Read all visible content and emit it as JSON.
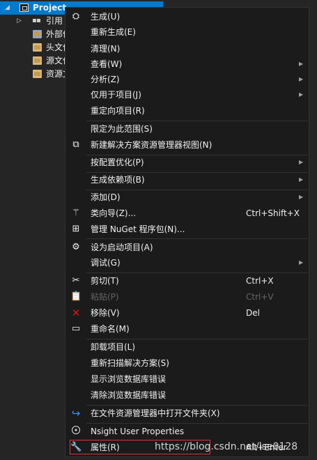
{
  "tree": {
    "project_label": "Project",
    "items": [
      {
        "label": "引用"
      },
      {
        "label": "外部依"
      },
      {
        "label": "头文件"
      },
      {
        "label": "源文件"
      },
      {
        "label": "资源文"
      }
    ]
  },
  "menu": {
    "build": {
      "label": "生成(U)"
    },
    "rebuild": {
      "label": "重新生成(E)"
    },
    "clean": {
      "label": "清理(N)"
    },
    "view": {
      "label": "查看(W)"
    },
    "analyze": {
      "label": "分析(Z)"
    },
    "project_only": {
      "label": "仅用于项目(J)"
    },
    "retarget": {
      "label": "重定向项目(R)"
    },
    "scope": {
      "label": "限定为此范围(S)"
    },
    "new_view": {
      "label": "新建解决方案资源管理器视图(N)"
    },
    "pgo": {
      "label": "按配置优化(P)"
    },
    "build_deps": {
      "label": "生成依赖项(B)"
    },
    "add": {
      "label": "添加(D)"
    },
    "class_wizard": {
      "label": "类向导(Z)...",
      "shortcut": "Ctrl+Shift+X"
    },
    "nuget": {
      "label": "管理 NuGet 程序包(N)..."
    },
    "set_startup": {
      "label": "设为启动项目(A)"
    },
    "debug": {
      "label": "调试(G)"
    },
    "cut": {
      "label": "剪切(T)",
      "shortcut": "Ctrl+X"
    },
    "paste": {
      "label": "粘贴(P)",
      "shortcut": "Ctrl+V"
    },
    "remove": {
      "label": "移除(V)",
      "shortcut": "Del"
    },
    "rename": {
      "label": "重命名(M)"
    },
    "unload": {
      "label": "卸载项目(L)"
    },
    "rescan": {
      "label": "重新扫描解决方案(S)"
    },
    "show_db_errors": {
      "label": "显示浏览数据库错误"
    },
    "clear_db_errors": {
      "label": "清除浏览数据库错误"
    },
    "open_folder": {
      "label": "在文件资源管理器中打开文件夹(X)"
    },
    "nsight": {
      "label": "Nsight User Properties"
    },
    "properties": {
      "label": "属性(R)",
      "shortcut": "Alt+Enter"
    }
  },
  "submenu_glyph": "▶",
  "watermark": "https://blog.csdn.net/lse0128",
  "colors": {
    "menu_bg": "#1b1b1c",
    "selection": "#007acc",
    "highlight_box": "#d6383a",
    "remove_icon": "#e51400",
    "open_folder_icon": "#3794ff"
  }
}
